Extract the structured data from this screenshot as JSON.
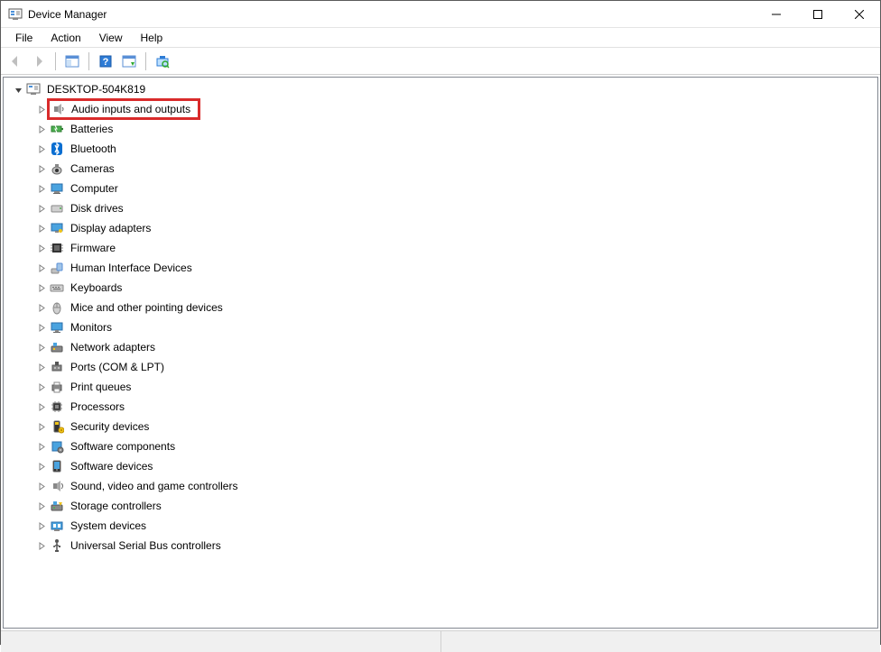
{
  "window": {
    "title": "Device Manager"
  },
  "menu": {
    "items": [
      "File",
      "Action",
      "View",
      "Help"
    ]
  },
  "toolbar": {
    "back": "Back",
    "forward": "Forward",
    "show_hide_tree": "Show/Hide Console Tree",
    "help": "Help",
    "action_on_selected": "Action on selected item",
    "scan": "Scan for hardware changes"
  },
  "tree": {
    "root": {
      "label": "DESKTOP-504K819",
      "expanded": true
    },
    "categories": [
      {
        "label": "Audio inputs and outputs",
        "icon": "speaker",
        "highlighted": true
      },
      {
        "label": "Batteries",
        "icon": "battery"
      },
      {
        "label": "Bluetooth",
        "icon": "bluetooth"
      },
      {
        "label": "Cameras",
        "icon": "camera"
      },
      {
        "label": "Computer",
        "icon": "computer"
      },
      {
        "label": "Disk drives",
        "icon": "disk"
      },
      {
        "label": "Display adapters",
        "icon": "display"
      },
      {
        "label": "Firmware",
        "icon": "firmware"
      },
      {
        "label": "Human Interface Devices",
        "icon": "hid"
      },
      {
        "label": "Keyboards",
        "icon": "keyboard"
      },
      {
        "label": "Mice and other pointing devices",
        "icon": "mouse"
      },
      {
        "label": "Monitors",
        "icon": "monitor"
      },
      {
        "label": "Network adapters",
        "icon": "network"
      },
      {
        "label": "Ports (COM & LPT)",
        "icon": "port"
      },
      {
        "label": "Print queues",
        "icon": "printer"
      },
      {
        "label": "Processors",
        "icon": "cpu"
      },
      {
        "label": "Security devices",
        "icon": "security"
      },
      {
        "label": "Software components",
        "icon": "swcomp"
      },
      {
        "label": "Software devices",
        "icon": "swdev"
      },
      {
        "label": "Sound, video and game controllers",
        "icon": "sound"
      },
      {
        "label": "Storage controllers",
        "icon": "storage"
      },
      {
        "label": "System devices",
        "icon": "system"
      },
      {
        "label": "Universal Serial Bus controllers",
        "icon": "usb"
      }
    ]
  }
}
